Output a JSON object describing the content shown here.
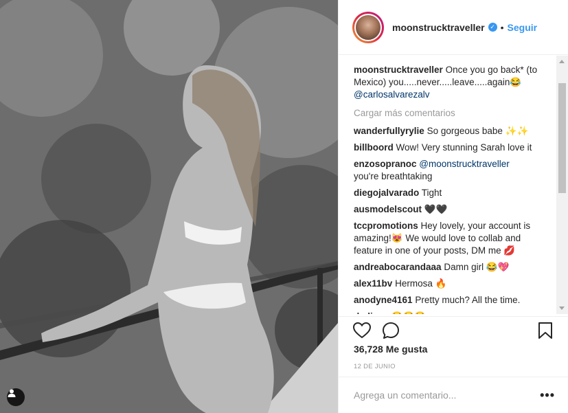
{
  "post": {
    "username": "moonstrucktraveller",
    "verified_icon": "verified-badge-icon",
    "separator": "•",
    "follow_label": "Seguir",
    "caption": {
      "user": "moonstrucktraveller",
      "text": "Once you go back* (to Mexico) you.....never.....leave.....again😂",
      "mention": "@carlosalvarezalv"
    },
    "load_more_label": "Cargar más comentarios",
    "comments": [
      {
        "user": "wanderfullyrylie",
        "text": "So gorgeous babe ✨✨"
      },
      {
        "user": "billboord",
        "text": "Wow! Very stunning Sarah love it"
      },
      {
        "user": "enzosopranoc",
        "mention": "@moonstrucktraveller",
        "text": "you're breathtaking"
      },
      {
        "user": "diegojalvarado",
        "text": "Tight"
      },
      {
        "user": "ausmodelscout",
        "text": "🖤🖤"
      },
      {
        "user": "tccpromotions",
        "text": "Hey lovely, your account is amazing!😻 We would love to collab and feature in one of your posts, DM me 💋"
      },
      {
        "user": "andreabocarandaaa",
        "text": "Damn girl 😂💖"
      },
      {
        "user": "alex11bv",
        "text": "Hermosa 🔥"
      },
      {
        "user": "anodyne4161",
        "text": "Pretty much? All the time."
      },
      {
        "user": "dedieus",
        "text": "😂😂😂"
      }
    ],
    "likes_label": "36,728 Me gusta",
    "date_label": "12 DE JUNIO",
    "comment_placeholder": "Agrega un comentario...",
    "more_label": "•••"
  },
  "colors": {
    "accent": "#3897f0",
    "text": "#262626",
    "muted": "#999999",
    "border": "#efefef"
  }
}
